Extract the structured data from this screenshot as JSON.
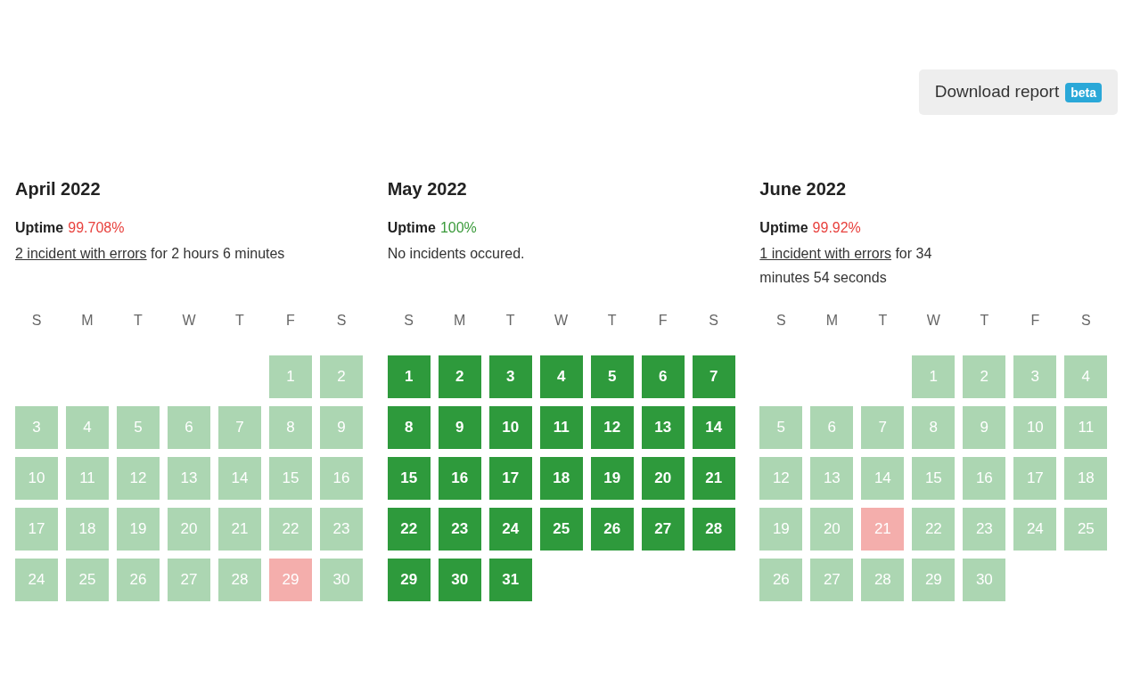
{
  "download_button": {
    "label": "Download report",
    "badge": "beta"
  },
  "months": [
    {
      "title": "April 2022",
      "uptime_label": "Uptime",
      "uptime": "99.708%",
      "uptime_ok": false,
      "incident_link": "2 incident with errors",
      "summary": " for 2 hours 6 minutes",
      "selected": false,
      "weekdays": [
        "S",
        "M",
        "T",
        "W",
        "T",
        "F",
        "S"
      ],
      "weeks": [
        [
          {
            "day": "1",
            "incident": false
          },
          {
            "day": "2",
            "incident": false
          }
        ],
        [
          {
            "day": "3",
            "incident": false
          },
          {
            "day": "4",
            "incident": false
          },
          {
            "day": "5",
            "incident": false
          },
          {
            "day": "6",
            "incident": false
          },
          {
            "day": "7",
            "incident": false
          },
          {
            "day": "8",
            "incident": false
          },
          {
            "day": "9",
            "incident": false
          }
        ],
        [
          {
            "day": "10",
            "incident": false
          },
          {
            "day": "11",
            "incident": false
          },
          {
            "day": "12",
            "incident": false
          },
          {
            "day": "13",
            "incident": false
          },
          {
            "day": "14",
            "incident": false
          },
          {
            "day": "15",
            "incident": false
          },
          {
            "day": "16",
            "incident": false
          }
        ],
        [
          {
            "day": "17",
            "incident": false
          },
          {
            "day": "18",
            "incident": false
          },
          {
            "day": "19",
            "incident": false
          },
          {
            "day": "20",
            "incident": false
          },
          {
            "day": "21",
            "incident": false
          },
          {
            "day": "22",
            "incident": false
          },
          {
            "day": "23",
            "incident": false
          }
        ],
        [
          {
            "day": "24",
            "incident": false
          },
          {
            "day": "25",
            "incident": false
          },
          {
            "day": "26",
            "incident": false
          },
          {
            "day": "27",
            "incident": false
          },
          {
            "day": "28",
            "incident": false
          },
          {
            "day": "29",
            "incident": true
          },
          {
            "day": "30",
            "incident": false
          }
        ]
      ]
    },
    {
      "title": "May 2022",
      "uptime_label": "Uptime",
      "uptime": "100%",
      "uptime_ok": true,
      "summary": "No incidents occured.",
      "selected": true,
      "weekdays": [
        "S",
        "M",
        "T",
        "W",
        "T",
        "F",
        "S"
      ],
      "weeks": [
        [
          {
            "day": "1",
            "incident": false
          },
          {
            "day": "2",
            "incident": false
          },
          {
            "day": "3",
            "incident": false
          },
          {
            "day": "4",
            "incident": false
          },
          {
            "day": "5",
            "incident": false
          },
          {
            "day": "6",
            "incident": false
          },
          {
            "day": "7",
            "incident": false
          }
        ],
        [
          {
            "day": "8",
            "incident": false
          },
          {
            "day": "9",
            "incident": false
          },
          {
            "day": "10",
            "incident": false
          },
          {
            "day": "11",
            "incident": false
          },
          {
            "day": "12",
            "incident": false
          },
          {
            "day": "13",
            "incident": false
          },
          {
            "day": "14",
            "incident": false
          }
        ],
        [
          {
            "day": "15",
            "incident": false
          },
          {
            "day": "16",
            "incident": false
          },
          {
            "day": "17",
            "incident": false
          },
          {
            "day": "18",
            "incident": false
          },
          {
            "day": "19",
            "incident": false
          },
          {
            "day": "20",
            "incident": false
          },
          {
            "day": "21",
            "incident": false
          }
        ],
        [
          {
            "day": "22",
            "incident": false
          },
          {
            "day": "23",
            "incident": false
          },
          {
            "day": "24",
            "incident": false
          },
          {
            "day": "25",
            "incident": false
          },
          {
            "day": "26",
            "incident": false
          },
          {
            "day": "27",
            "incident": false
          },
          {
            "day": "28",
            "incident": false
          }
        ],
        [
          {
            "day": "29",
            "incident": false
          },
          {
            "day": "30",
            "incident": false
          },
          {
            "day": "31",
            "incident": false
          }
        ]
      ]
    },
    {
      "title": "June 2022",
      "uptime_label": "Uptime",
      "uptime": "99.92%",
      "uptime_ok": false,
      "incident_link": "1 incident with errors",
      "summary": " for 34 minutes 54 seconds",
      "selected": false,
      "weekdays": [
        "S",
        "M",
        "T",
        "W",
        "T",
        "F",
        "S"
      ],
      "weeks": [
        [
          {
            "day": "1",
            "incident": false
          },
          {
            "day": "2",
            "incident": false
          },
          {
            "day": "3",
            "incident": false
          },
          {
            "day": "4",
            "incident": false
          }
        ],
        [
          {
            "day": "5",
            "incident": false
          },
          {
            "day": "6",
            "incident": false
          },
          {
            "day": "7",
            "incident": false
          },
          {
            "day": "8",
            "incident": false
          },
          {
            "day": "9",
            "incident": false
          },
          {
            "day": "10",
            "incident": false
          },
          {
            "day": "11",
            "incident": false
          }
        ],
        [
          {
            "day": "12",
            "incident": false
          },
          {
            "day": "13",
            "incident": false
          },
          {
            "day": "14",
            "incident": false
          },
          {
            "day": "15",
            "incident": false
          },
          {
            "day": "16",
            "incident": false
          },
          {
            "day": "17",
            "incident": false
          },
          {
            "day": "18",
            "incident": false
          }
        ],
        [
          {
            "day": "19",
            "incident": false
          },
          {
            "day": "20",
            "incident": false
          },
          {
            "day": "21",
            "incident": true
          },
          {
            "day": "22",
            "incident": false
          },
          {
            "day": "23",
            "incident": false
          },
          {
            "day": "24",
            "incident": false
          },
          {
            "day": "25",
            "incident": false
          }
        ],
        [
          {
            "day": "26",
            "incident": false
          },
          {
            "day": "27",
            "incident": false
          },
          {
            "day": "28",
            "incident": false
          },
          {
            "day": "29",
            "incident": false
          },
          {
            "day": "30",
            "incident": false
          }
        ]
      ]
    }
  ]
}
